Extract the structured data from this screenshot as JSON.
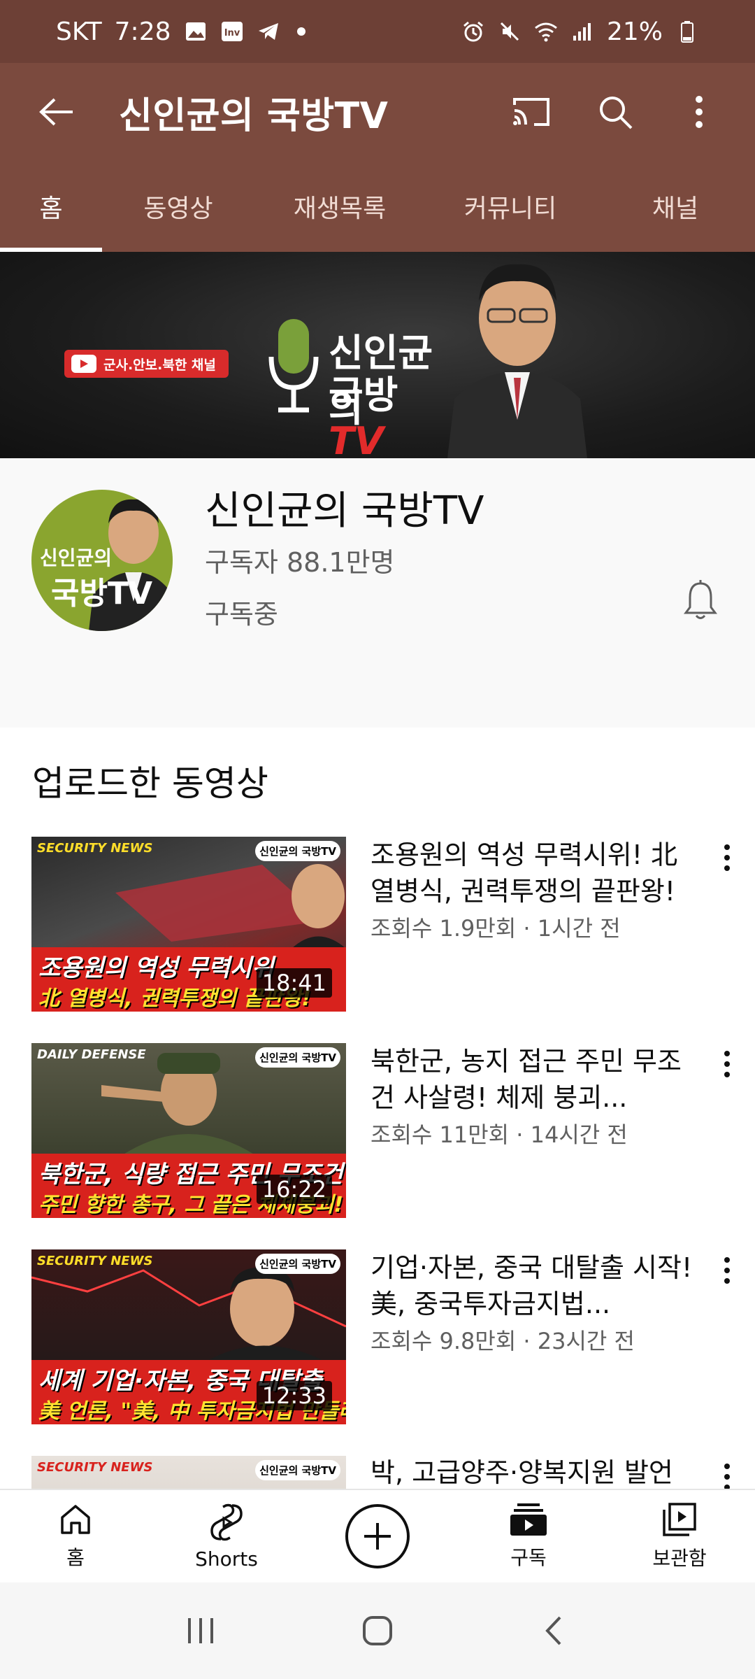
{
  "status_bar": {
    "carrier": "SKT",
    "time": "7:28",
    "battery": "21%"
  },
  "app_bar": {
    "title": "신인균의 국방TV"
  },
  "tabs": [
    {
      "label": "홈",
      "active": true
    },
    {
      "label": "동영상",
      "active": false
    },
    {
      "label": "재생목록",
      "active": false
    },
    {
      "label": "커뮤니티",
      "active": false
    },
    {
      "label": "채널",
      "active": false
    }
  ],
  "banner": {
    "pill_text": "군사.안보.북한 채널",
    "logo_line1": "신인균의",
    "logo_line2": "국방",
    "logo_tv": "TV"
  },
  "channel": {
    "name": "신인균의 국방TV",
    "subscribers": "구독자 88.1만명",
    "status": "구독중",
    "avatar_text1": "신인균의",
    "avatar_text2": "국방TV"
  },
  "section": {
    "title": "업로드한 동영상"
  },
  "videos": [
    {
      "title": "조용원의 역성 무력시위! 北 열병식, 권력투쟁의 끝판왕!",
      "meta": "조회수 1.9만회 · 1시간 전",
      "duration": "18:41",
      "thumb_brand": "SECURITY NEWS",
      "thumb_line1": "조용원의 역성 무력시위",
      "thumb_line2": "北 열병식, 권력투쟁의 끝판왕!",
      "thumb_logo": "신인균의 국방TV"
    },
    {
      "title": "북한군, 농지 접근 주민 무조건 사살령! 체제 붕괴...",
      "meta": "조회수 11만회 · 14시간 전",
      "duration": "16:22",
      "thumb_brand": "DAILY DEFENSE",
      "thumb_line1": "북한군, 식량 접근 주민 무조건",
      "thumb_line2": "주민 향한 총구, 그 끝은 체제붕괴!",
      "thumb_logo": "신인균의 국방TV"
    },
    {
      "title": "기업·자본, 중국 대탈출 시작! 美, 중국투자금지법...",
      "meta": "조회수 9.8만회 · 23시간 전",
      "duration": "12:33",
      "thumb_brand": "SECURITY NEWS",
      "thumb_line1": "세계 기업·자본, 중국 대탈출",
      "thumb_line2": "美 언론, \"美, 中 투자금지법 만들라\"",
      "thumb_logo": "신인균의 국방TV"
    },
    {
      "title": "박, 고급양주·양복지원 발언",
      "meta": "",
      "duration": "",
      "thumb_brand": "SECURITY NEWS",
      "thumb_line1": "",
      "thumb_line2": "",
      "thumb_logo": "신인균의 국방TV"
    }
  ],
  "bottom_nav": [
    {
      "label": "홈",
      "icon": "home-icon"
    },
    {
      "label": "Shorts",
      "icon": "shorts-icon"
    },
    {
      "label": "",
      "icon": "add-icon"
    },
    {
      "label": "구독",
      "icon": "subscriptions-icon"
    },
    {
      "label": "보관함",
      "icon": "library-icon"
    }
  ],
  "colors": {
    "app_bar": "#7b4a3e",
    "status_bar": "#6d4036",
    "accent_red": "#d8221d"
  }
}
